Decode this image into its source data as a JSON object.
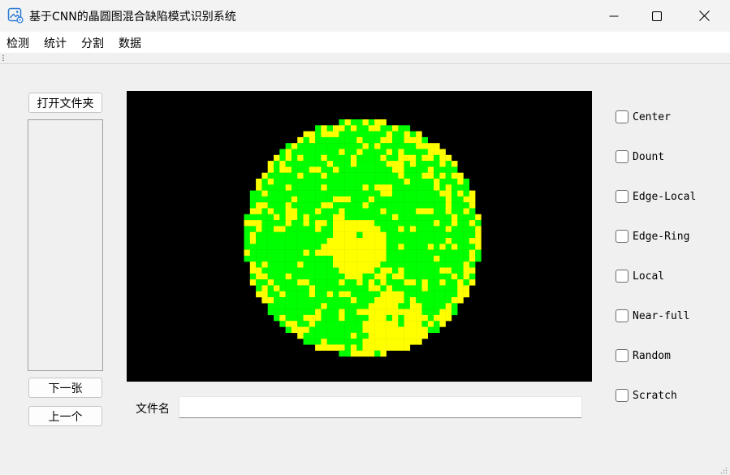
{
  "window": {
    "title": "基于CNN的晶圆图混合缺陷模式识别系统",
    "icons": {
      "app": "image-settings-icon",
      "minimize": "minimize-icon",
      "maximize": "maximize-icon",
      "close": "close-icon"
    }
  },
  "menubar": {
    "items": [
      {
        "label": "检测"
      },
      {
        "label": "统计"
      },
      {
        "label": "分割"
      },
      {
        "label": "数据"
      }
    ]
  },
  "left_panel": {
    "open_folder_label": "打开文件夹",
    "next_label": "下一张",
    "prev_label": "上一个",
    "file_list": []
  },
  "viewer": {
    "description_colors": {
      "background": "#000000",
      "normal_die": "#00ff00",
      "defect_die": "#ffff00"
    },
    "filename_label": "文件名",
    "filename_value": ""
  },
  "checkboxes": [
    {
      "label": "Center",
      "checked": false
    },
    {
      "label": "Dount",
      "checked": false
    },
    {
      "label": "Edge-Local",
      "checked": false
    },
    {
      "label": "Edge-Ring",
      "checked": false
    },
    {
      "label": "Local",
      "checked": false
    },
    {
      "label": "Near-full",
      "checked": false
    },
    {
      "label": "Random",
      "checked": false
    },
    {
      "label": "Scratch",
      "checked": false
    }
  ]
}
